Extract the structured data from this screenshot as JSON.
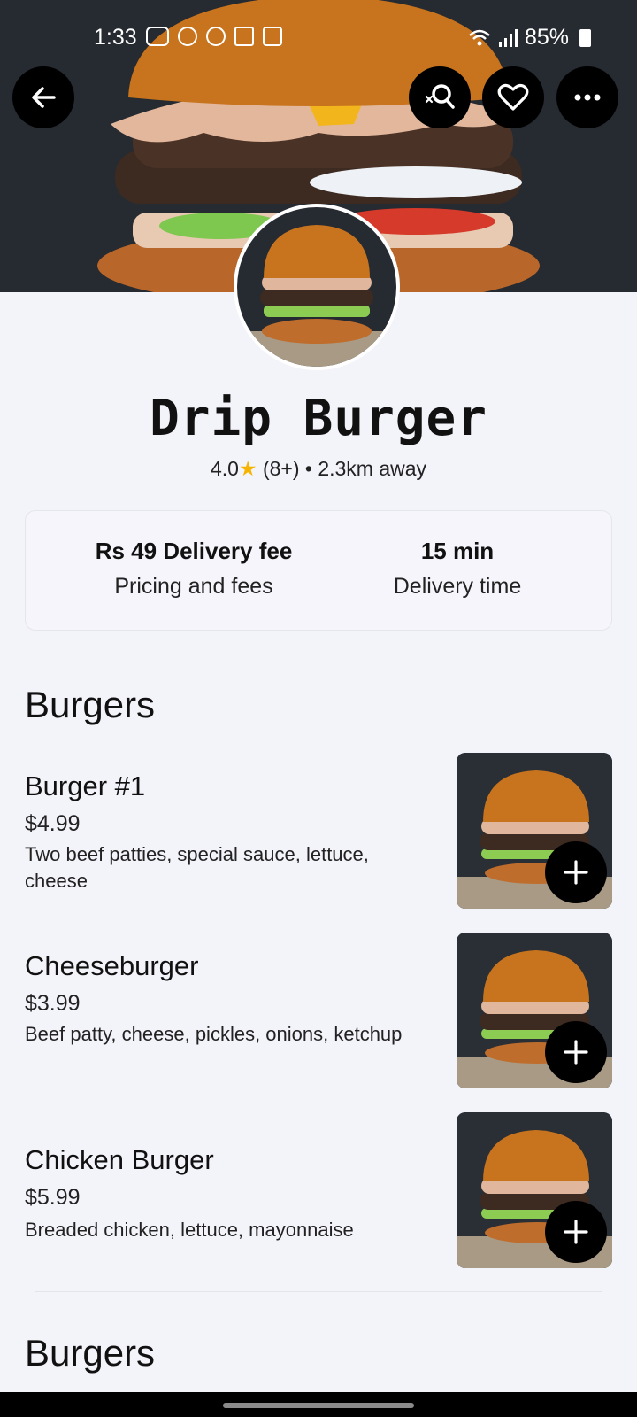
{
  "status_bar": {
    "time": "1:33",
    "battery": "85%"
  },
  "store": {
    "name": "Drip Burger",
    "rating": "4.0",
    "reviews": "(8+)",
    "distance": "2.3km away",
    "delivery_fee": "Rs 49 Delivery fee",
    "fee_sub": "Pricing and fees",
    "delivery_time": "15 min",
    "time_sub": "Delivery time"
  },
  "sections": [
    {
      "title": "Burgers",
      "items": [
        {
          "name": "Burger #1",
          "price": "$4.99",
          "desc": "Two beef patties, special sauce, lettuce, cheese"
        },
        {
          "name": "Cheeseburger",
          "price": "$3.99",
          "desc": "Beef patty, cheese, pickles, onions, ketchup"
        },
        {
          "name": "Chicken Burger",
          "price": "$5.99",
          "desc": "Breaded chicken, lettuce, mayonnaise"
        }
      ]
    },
    {
      "title": "Burgers"
    }
  ],
  "icons": {
    "back": "arrow-left-icon",
    "search": "search-icon",
    "favorite": "heart-icon",
    "more": "more-horizontal-icon",
    "add": "plus-icon",
    "rating_star": "star-icon"
  },
  "colors": {
    "accent_star": "#f6b400",
    "button_bg": "#000000",
    "page_bg": "#f3f3fa"
  }
}
